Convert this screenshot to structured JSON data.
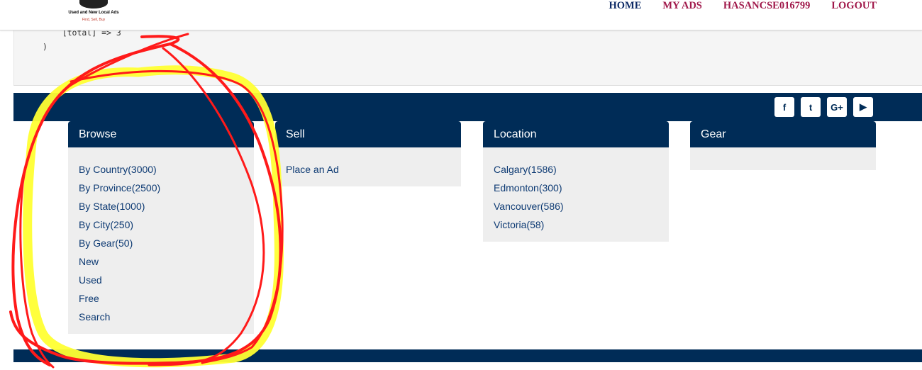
{
  "header": {
    "logo": {
      "title": "Used and New Local Ads",
      "tagline": "Find, Sell, Buy"
    },
    "nav": {
      "home": "HOME",
      "my_ads": "MY ADS",
      "user": "HASANCSE016799",
      "logout": "LOGOUT"
    }
  },
  "debug_output": {
    "line1": "    [total] => 3",
    "line2": ")"
  },
  "social": {
    "facebook": "f",
    "twitter": "t",
    "google_plus": "G+",
    "youtube": "▶"
  },
  "browse": {
    "title": "Browse",
    "links": [
      "By Country(3000)",
      "By Province(2500)",
      "By State(1000)",
      "By City(250)",
      "By Gear(50)",
      "New",
      "Used",
      "Free",
      "Search"
    ]
  },
  "sell": {
    "title": "Sell",
    "links": [
      "Place an Ad"
    ]
  },
  "location": {
    "title": "Location",
    "links": [
      "Calgary(1586)",
      "Edmonton(300)",
      "Vancouver(586)",
      "Victoria(58)"
    ]
  },
  "gear": {
    "title": "Gear"
  },
  "colors": {
    "navy": "#002c57",
    "nav_home": "#0d2a66",
    "nav_other": "#a0184a",
    "annotation_red": "#ff1a1a",
    "annotation_yellow": "#ffff33"
  }
}
